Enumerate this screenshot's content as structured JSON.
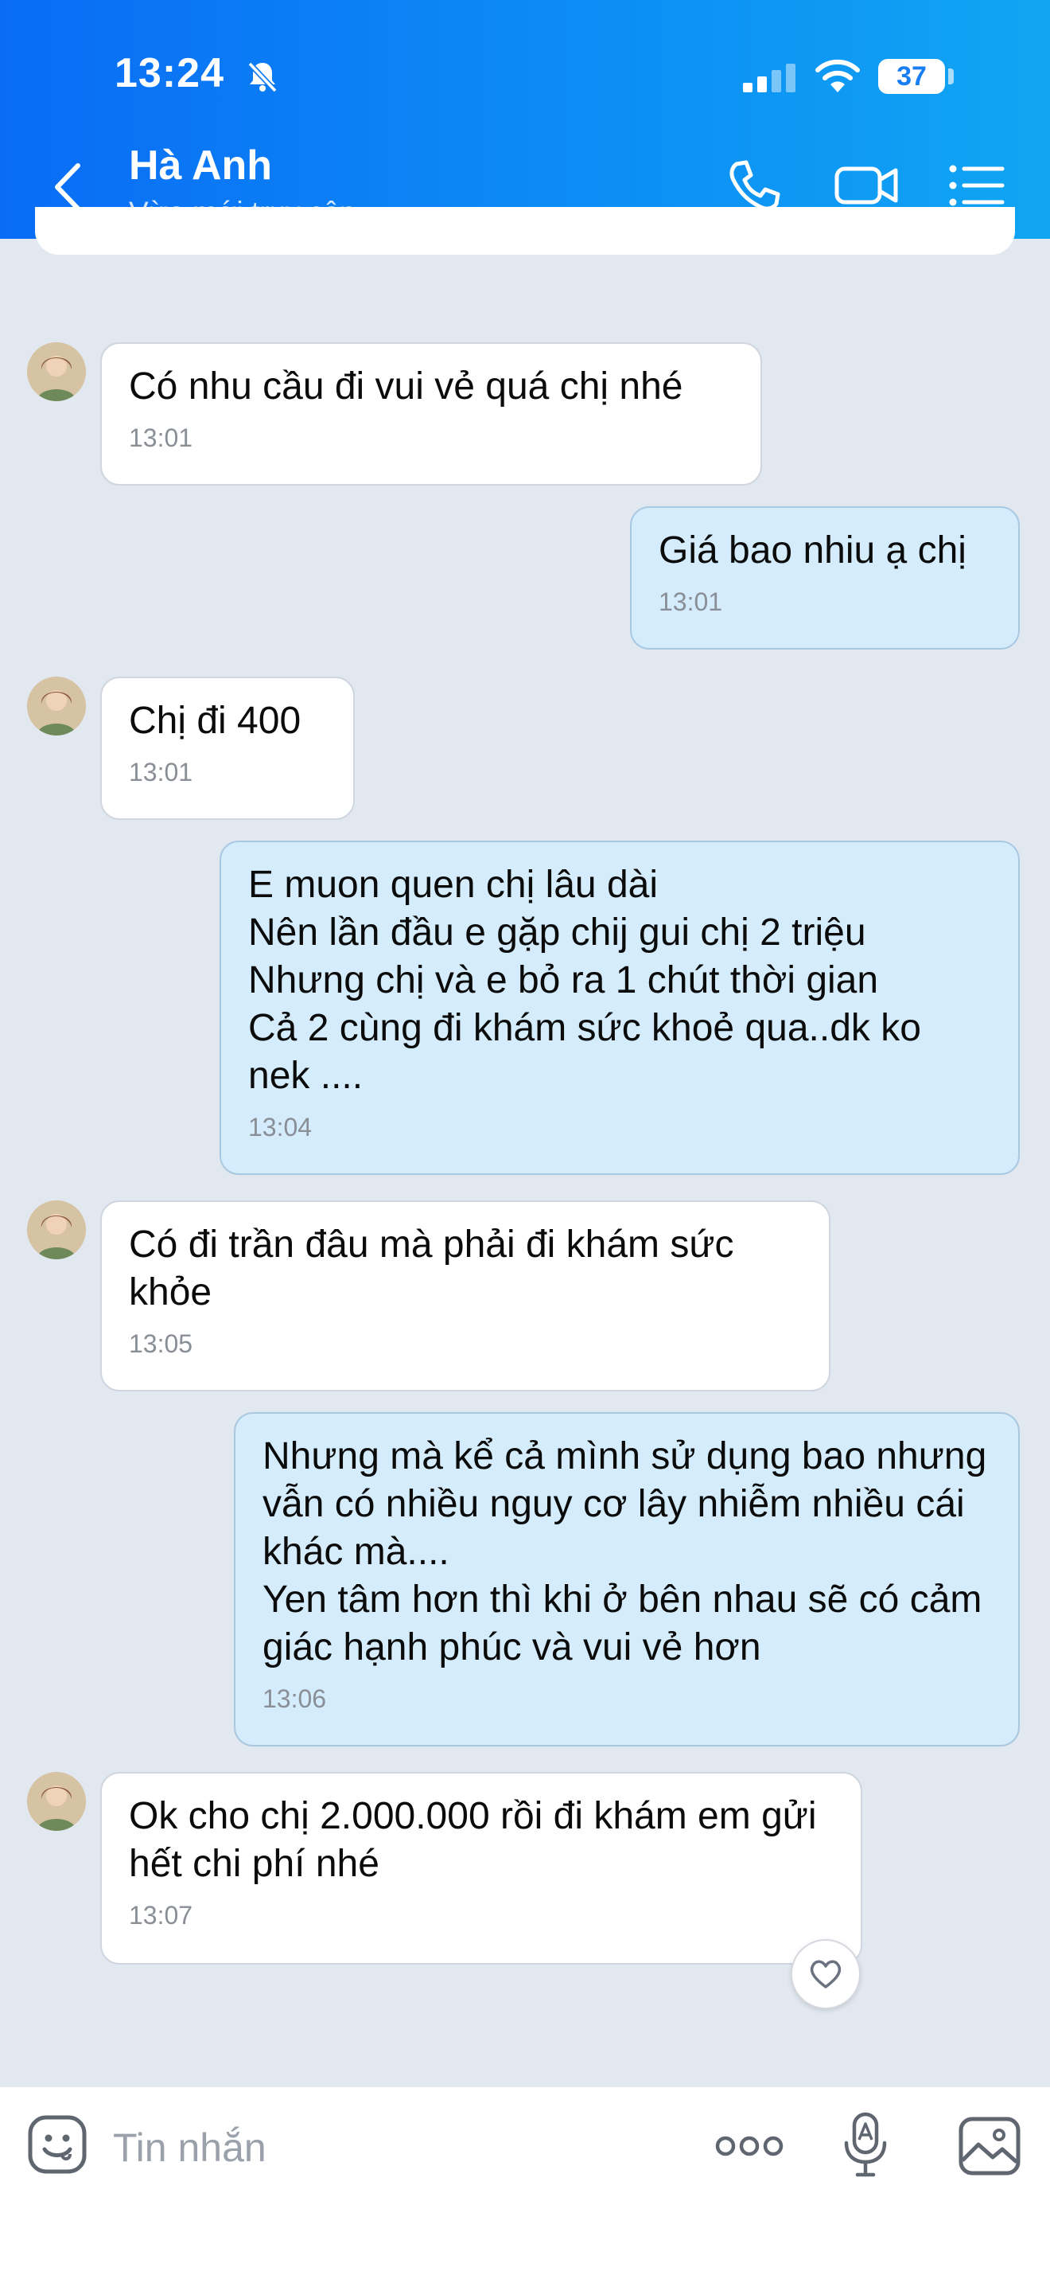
{
  "status_bar": {
    "time": "13:24",
    "battery": "37",
    "icons": [
      "bell-slash-icon",
      "signal-icon",
      "wifi-icon",
      "battery-icon"
    ]
  },
  "header": {
    "contact_name": "Hà Anh",
    "contact_status": "Vừa mới truy cập",
    "icons": [
      "back-icon",
      "phone-icon",
      "video-camera-icon",
      "menu-list-icon"
    ]
  },
  "messages": [
    {
      "direction": "in",
      "text": "Có nhu cầu đi vui vẻ quá chị nhé",
      "time": "13:01"
    },
    {
      "direction": "out",
      "text": "Giá bao nhiu ạ chị",
      "time": "13:01"
    },
    {
      "direction": "in",
      "text": "Chị đi 400",
      "time": "13:01"
    },
    {
      "direction": "out",
      "text": "E muon quen chị lâu dài\nNên lần đầu e gặp chij gui chị 2 triệu\nNhưng chị và e bỏ ra 1 chút thời gian\nCả 2 cùng đi khám sức khoẻ qua..dk ko nek ....",
      "time": "13:04"
    },
    {
      "direction": "in",
      "text": "Có đi trần đâu mà phải đi khám sức khỏe",
      "time": "13:05"
    },
    {
      "direction": "out",
      "text": "Nhưng mà kể cả mình sử dụng bao nhưng vẫn có nhiều nguy cơ lây nhiễm nhiều cái khác mà....\nYen tâm hơn thì khi ở bên nhau sẽ có cảm giác hạnh phúc và vui vẻ hơn",
      "time": "13:06"
    },
    {
      "direction": "in",
      "text": "Ok cho chị 2.000.000 rồi đi khám em gửi hết chi phí nhé",
      "time": "13:07"
    }
  ],
  "input_bar": {
    "placeholder": "Tin nhắn",
    "icons": [
      "emoji-icon",
      "more-dots-icon",
      "microphone-icon",
      "image-icon"
    ]
  },
  "colors": {
    "header_start": "#0a6cf5",
    "header_end": "#11a5f3",
    "background": "#e2e8f0",
    "incoming_bubble": "#ffffff",
    "outgoing_bubble": "#d4ecfb"
  }
}
